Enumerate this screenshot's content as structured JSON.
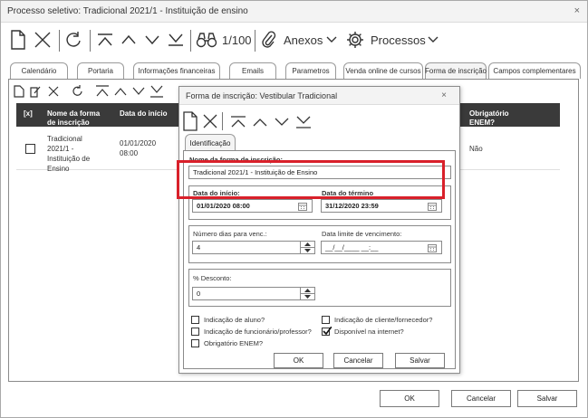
{
  "window": {
    "title": "Processo seletivo: Tradicional 2021/1 - Instituição de ensino",
    "close": "×"
  },
  "toolbar": {
    "counter": "1/100",
    "attachments_label": "Anexos",
    "processes_label": "Processos"
  },
  "tabs": [
    {
      "label": "Calendário"
    },
    {
      "label": "Portaria"
    },
    {
      "label": "Informações financeiras"
    },
    {
      "label": "Emails"
    },
    {
      "label": "Parametros"
    },
    {
      "label": "Venda online de cursos"
    },
    {
      "label": "Forma de inscrição"
    },
    {
      "label": "Campos complementares"
    }
  ],
  "grid": {
    "columns": {
      "select": "[x]",
      "name": "Nome da forma de inscrição",
      "start": "Data do início",
      "enem": "Obrigatório ENEM?"
    },
    "rows": [
      {
        "name": "Tradicional 2021/1 - Instituição de Ensino",
        "start_date": "01/01/2020",
        "start_time": "08:00",
        "enem": "Não"
      }
    ]
  },
  "footer": {
    "ok": "OK",
    "cancel": "Cancelar",
    "save": "Salvar"
  },
  "dialog": {
    "title": "Forma de inscrição: Vestibular Tradicional",
    "close": "×",
    "tab": "Identificação",
    "name_label": "Nome da forma de inscrição:",
    "name_value": "Tradicional 2021/1 - Instituição de Ensino",
    "start_label": "Data do início:",
    "start_value": "01/01/2020 08:00",
    "end_label": "Data do término",
    "end_value": "31/12/2020 23:59",
    "days_label": "Número dias para venc.:",
    "days_value": "4",
    "due_label": "Data limite de vencimento:",
    "due_value": "__/__/____ __:__",
    "discount_label": "% Desconto:",
    "discount_value": "0",
    "checkboxes": {
      "student": {
        "label": "Indicação de aluno?",
        "checked": false
      },
      "client": {
        "label": "Indicação de cliente/fornecedor?",
        "checked": false
      },
      "employee": {
        "label": "Indicação de funcionário/professor?",
        "checked": false
      },
      "internet": {
        "label": "Disponível na internet?",
        "checked": true
      },
      "enem": {
        "label": "Obrigatório ENEM?",
        "checked": false
      }
    },
    "ok": "OK",
    "cancel": "Cancelar",
    "save": "Salvar"
  },
  "colors": {
    "grid_header": "#3a3a3a",
    "highlight": "#d9202a"
  }
}
